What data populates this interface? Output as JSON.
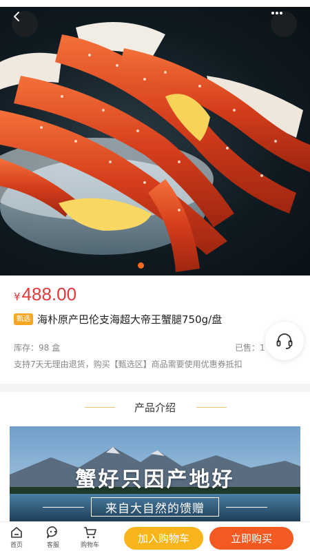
{
  "colors": {
    "price": "#e4393c",
    "badge": "#f5a623",
    "add_to_cart": "#f8b51b",
    "buy_now": "#f35a22",
    "indicator": "#f36b21"
  },
  "hero": {
    "image_icon": "king-crab-photo",
    "back_icon": "chevron-left-icon",
    "more_icon": "more-dots-icon",
    "current_slide": 1
  },
  "product": {
    "currency": "¥",
    "price": "488.00",
    "badge": "甄选",
    "title": "海朴原产巴伦支海超大帝王蟹腿750g/盘",
    "stock": "库存：98 盒",
    "sold": "已售：1",
    "notice": "支持7天无理由退货，购买【甄选区】商品需要使用优惠券抵扣"
  },
  "customer_service_icon": "headset-icon",
  "intro": {
    "title": "产品介绍",
    "banner_headline": "蟹好只因产地好",
    "banner_subline": "来自大自然的馈赠",
    "banner_icon": "mountain-lake-landscape"
  },
  "bottom_nav": {
    "home": {
      "label": "首页",
      "icon": "home-icon"
    },
    "service": {
      "label": "客服",
      "icon": "chat-icon"
    },
    "cart": {
      "label": "购物车",
      "icon": "cart-icon"
    },
    "add_to_cart": "加入购物车",
    "buy_now": "立即购买"
  }
}
